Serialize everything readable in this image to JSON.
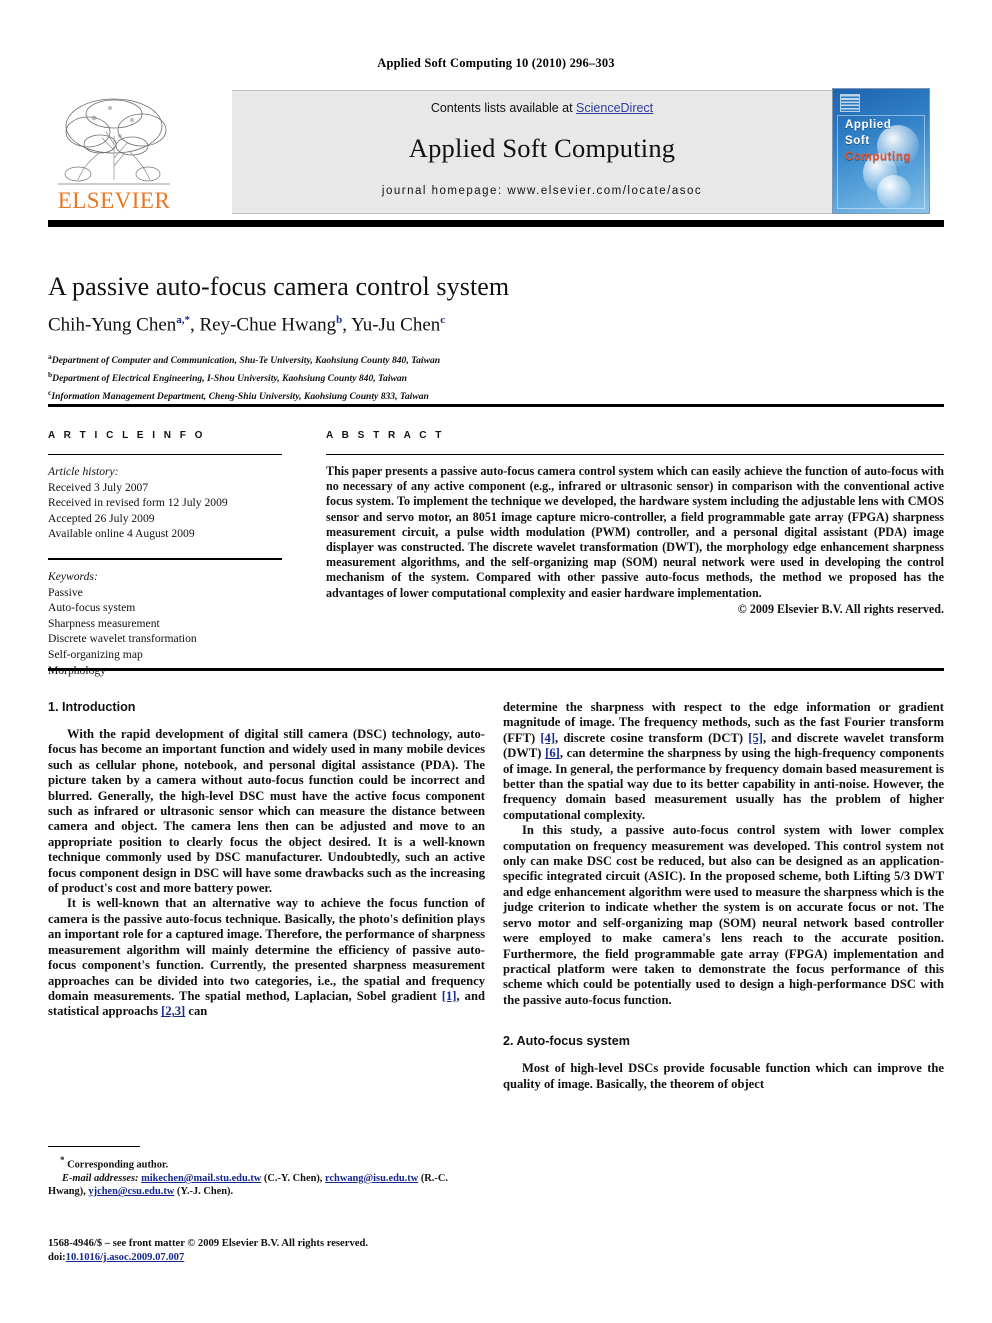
{
  "running_head": "Applied Soft Computing 10 (2010) 296–303",
  "masthead": {
    "contents_prefix": "Contents lists available at ",
    "sciencedirect": "ScienceDirect",
    "journal_name": "Applied Soft Computing",
    "homepage": "journal homepage: www.elsevier.com/locate/asoc",
    "publisher_logo_text": "ELSEVIER",
    "cover": {
      "line1": "Applied",
      "line2": "Soft",
      "line3": "Computing"
    },
    "colors": {
      "link_blue": "#2f3c9e",
      "elsevier_orange": "#e87722",
      "cover_blue": "#2f7fc6",
      "cover_red": "#e8502a",
      "band_grey": "#e8e8e8"
    }
  },
  "article": {
    "title": "A passive auto-focus camera control system",
    "authors_html": "Chih-Yung Chen<sup>a,*</sup>, Rey-Chue Hwang<sup>b</sup>, Yu-Ju Chen<sup>c</sup>",
    "affiliations": [
      {
        "marker": "a",
        "text": "Department of Computer and Communication, Shu-Te University, Kaohsiung County 840, Taiwan"
      },
      {
        "marker": "b",
        "text": "Department of Electrical Engineering, I-Shou University, Kaohsiung County 840, Taiwan"
      },
      {
        "marker": "c",
        "text": "Information Management Department, Cheng-Shiu University, Kaohsiung County 833, Taiwan"
      }
    ]
  },
  "article_info": {
    "heading": "A R T I C L E   I N F O",
    "history_label": "Article history:",
    "history": [
      "Received 3 July 2007",
      "Received in revised form 12 July 2009",
      "Accepted 26 July 2009",
      "Available online 4 August 2009"
    ],
    "keywords_label": "Keywords:",
    "keywords": [
      "Passive",
      "Auto-focus system",
      "Sharpness measurement",
      "Discrete wavelet transformation",
      "Self-organizing map",
      "Morphology"
    ]
  },
  "abstract": {
    "heading": "A B S T R A C T",
    "text": "This paper presents a passive auto-focus camera control system which can easily achieve the function of auto-focus with no necessary of any active component (e.g., infrared or ultrasonic sensor) in comparison with the conventional active focus system. To implement the technique we developed, the hardware system including the adjustable lens with CMOS sensor and servo motor, an 8051 image capture micro-controller, a field programmable gate array (FPGA) sharpness measurement circuit, a pulse width modulation (PWM) controller, and a personal digital assistant (PDA) image displayer was constructed. The discrete wavelet transformation (DWT), the morphology edge enhancement sharpness measurement algorithms, and the self-organizing map (SOM) neural network were used in developing the control mechanism of the system. Compared with other passive auto-focus methods, the method we proposed has the advantages of lower computational complexity and easier hardware implementation.",
    "copyright": "© 2009 Elsevier B.V. All rights reserved."
  },
  "body": {
    "section1_heading": "1. Introduction",
    "section2_heading": "2. Auto-focus system",
    "left_paragraphs": [
      "With the rapid development of digital still camera (DSC) technology, auto-focus has become an important function and widely used in many mobile devices such as cellular phone, notebook, and personal digital assistance (PDA). The picture taken by a camera without auto-focus function could be incorrect and blurred. Generally, the high-level DSC must have the active focus component such as infrared or ultrasonic sensor which can measure the distance between camera and object. The camera lens then can be adjusted and move to an appropriate position to clearly focus the object desired. It is a well-known technique commonly used by DSC manufacturer. Undoubtedly, such an active focus component design in DSC will have some drawbacks such as the increasing of product's cost and more battery power."
    ],
    "left_paragraph2_pre": "It is well-known that an alternative way to achieve the focus function of camera is the passive auto-focus technique. Basically, the photo's definition plays an important role for a captured image. Therefore, the performance of sharpness measurement algorithm will mainly determine the efficiency of passive auto-focus component's function. Currently, the presented sharpness measurement approaches can be divided into two categories, i.e., the spatial and frequency domain measurements. The spatial method, Laplacian, Sobel gradient ",
    "left_paragraph2_ref1": "[1]",
    "left_paragraph2_mid": ", and statistical approachs ",
    "left_paragraph2_ref2": "[2,3]",
    "left_paragraph2_post": " can",
    "right_paragraph1_pre": "determine the sharpness with respect to the edge information or gradient magnitude of image. The frequency methods, such as the fast Fourier transform (FFT) ",
    "right_p1_ref1": "[4]",
    "right_p1_a": ", discrete cosine transform (DCT) ",
    "right_p1_ref2": "[5]",
    "right_p1_b": ", and discrete wavelet transform (DWT) ",
    "right_p1_ref3": "[6]",
    "right_p1_post": ", can determine the sharpness by using the high-frequency components of image. In general, the performance by frequency domain based measurement is better than the spatial way due to its better capability in anti-noise. However, the frequency domain based measurement usually has the problem of higher computational complexity.",
    "right_paragraph2": "In this study, a passive auto-focus control system with lower complex computation on frequency measurement was developed. This control system not only can make DSC cost be reduced, but also can be designed as an application-specific integrated circuit (ASIC). In the proposed scheme, both Lifting 5/3 DWT and edge enhancement algorithm were used to measure the sharpness which is the judge criterion to indicate whether the system is on accurate focus or not. The servo motor and self-organizing map (SOM) neural network based controller were employed to make camera's lens reach to the accurate position. Furthermore, the field programmable gate array (FPGA) implementation and practical platform were taken to demonstrate the focus performance of this scheme which could be potentially used to design a high-performance DSC with the passive auto-focus function.",
    "right_paragraph3": "Most of high-level DSCs provide focusable function which can improve the quality of image. Basically, the theorem of object"
  },
  "footnotes": {
    "corresponding": "Corresponding author.",
    "email_label": "E-mail addresses:",
    "email1": "mikechen@mail.stu.edu.tw",
    "email1_name": " (C.-Y. Chen), ",
    "email2": "rchwang@isu.edu.tw",
    "email2_name": " (R.-C. Hwang), ",
    "email3": "yjchen@csu.edu.tw",
    "email3_name": " (Y.-J. Chen)."
  },
  "footer": {
    "issn_line": "1568-4946/$ – see front matter © 2009 Elsevier B.V. All rights reserved.",
    "doi_label": "doi:",
    "doi": "10.1016/j.asoc.2009.07.007"
  }
}
